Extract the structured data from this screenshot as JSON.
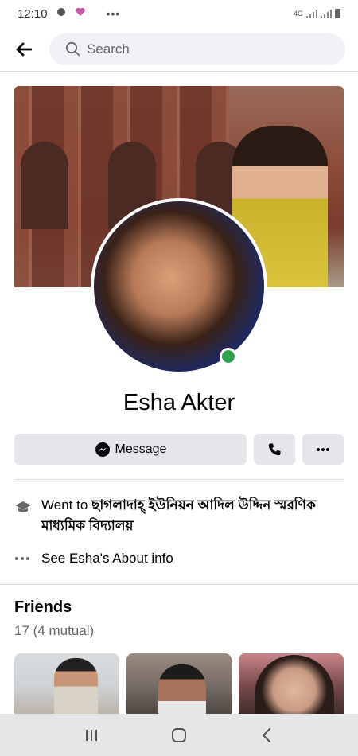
{
  "status_bar": {
    "time": "12:10",
    "more": "•••",
    "network": "4G"
  },
  "header": {
    "search_placeholder": "Search"
  },
  "profile": {
    "name": "Esha Akter",
    "online_color": "#31a24c"
  },
  "actions": {
    "message_label": "Message"
  },
  "intro": {
    "education_prefix": "Went to",
    "education_school": "ছাগলাদাহ্ ইউনিয়ন আদিল উদ্দিন স্মরণিক মাধ্যমিক বিদ্যালয়",
    "about_link": "See Esha's About info"
  },
  "friends": {
    "title": "Friends",
    "count": "17 (4 mutual)"
  },
  "colors": {
    "button_bg": "#e4e6eb",
    "divider": "#dddfe2",
    "secondary_text": "#65676b"
  }
}
